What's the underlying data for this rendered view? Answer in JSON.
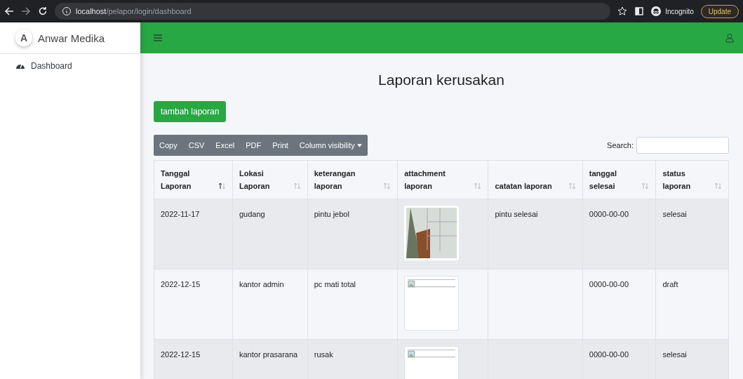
{
  "browser": {
    "url_host": "localhost",
    "url_path": "/pelapor/login/dashboard",
    "profile": "Incognito",
    "update_button": "Update"
  },
  "sidebar": {
    "brand_letter": "A",
    "brand": "Anwar Medika",
    "items": [
      {
        "label": "Dashboard",
        "selected": false
      }
    ]
  },
  "page": {
    "title": "Laporan kerusakan",
    "add_button": "tambah laporan"
  },
  "toolbar": {
    "buttons": [
      "Copy",
      "CSV",
      "Excel",
      "PDF",
      "Print",
      "Column visibility"
    ],
    "search_label": "Search:"
  },
  "table": {
    "columns": [
      {
        "label": "Tanggal Laporan",
        "sorted": true
      },
      {
        "label": "Lokasi Laporan",
        "sorted": false
      },
      {
        "label": "keterangan laporan",
        "sorted": false
      },
      {
        "label": "attachment laporan",
        "sorted": false
      },
      {
        "label": "catatan laporan",
        "sorted": false
      },
      {
        "label": "tanggal selesai",
        "sorted": false
      },
      {
        "label": "status laporan",
        "sorted": false
      }
    ],
    "rows": [
      {
        "tanggal": "2022-11-17",
        "lokasi": "gudang",
        "keterangan": "pintu jebol",
        "attachment": {
          "kind": "photo"
        },
        "catatan": "pintu selesai",
        "selesai": "0000-00-00",
        "status": "selesai"
      },
      {
        "tanggal": "2022-12-15",
        "lokasi": "kantor admin",
        "keterangan": "pc mati total",
        "attachment": {
          "kind": "broken"
        },
        "selesai": "0000-00-00",
        "status": "draft"
      },
      {
        "tanggal": "2022-12-15",
        "lokasi": "kantor prasarana",
        "keterangan": "rusak",
        "attachment": {
          "kind": "broken"
        },
        "selesai": "0000-00-00",
        "status": "selesai"
      }
    ]
  }
}
